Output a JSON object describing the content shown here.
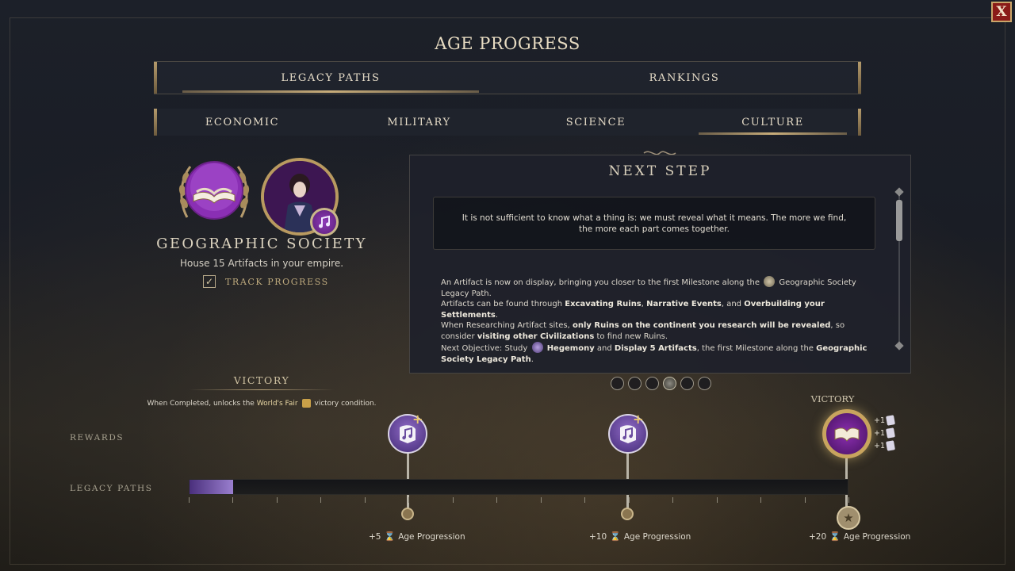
{
  "window": {
    "title": "AGE PROGRESS",
    "close_label": "X"
  },
  "main_tabs": [
    {
      "label": "LEGACY PATHS",
      "active": true
    },
    {
      "label": "RANKINGS",
      "active": false
    }
  ],
  "sub_tabs": [
    {
      "label": "ECONOMIC",
      "active": false
    },
    {
      "label": "MILITARY",
      "active": false
    },
    {
      "label": "SCIENCE",
      "active": false
    },
    {
      "label": "CULTURE",
      "active": true
    }
  ],
  "legacy": {
    "name": "GEOGRAPHIC SOCIETY",
    "description": "House 15 Artifacts in your empire.",
    "track_label": "TRACK PROGRESS",
    "track_checked": true,
    "icons": [
      "open-book-icon",
      "leader-portrait",
      "music-note-icon"
    ]
  },
  "next_step": {
    "title": "NEXT STEP",
    "quote": "It is not sufficient to know what a thing is: we must reveal what it means. The more we find, the more each part comes together.",
    "body": {
      "p1_a": "An Artifact is now on display, bringing you closer to the first Milestone along the",
      "p1_b": "Geographic Society Legacy Path.",
      "p2_a": "Artifacts can be found through",
      "p2_b1": "Excavating Ruins",
      "p2_sep1": ",",
      "p2_b2": "Narrative Events",
      "p2_sep2": ", and",
      "p2_b3": "Overbuilding your Settlements",
      "p2_end": ".",
      "p3_a": "When Researching Artifact sites,",
      "p3_b": "only Ruins on the continent you research will be revealed",
      "p3_c": ", so consider",
      "p3_d": "visiting other Civilizations",
      "p3_e": "to find new Ruins.",
      "p4_a": "Next Objective: Study",
      "p4_b1": "Hegemony",
      "p4_c": "and",
      "p4_b2": "Display 5 Artifacts",
      "p4_d": ", the first Milestone along the",
      "p4_b3": "Geographic Society Legacy Path",
      "p4_end": "."
    },
    "pages": 6,
    "active_page": 4
  },
  "victory": {
    "title": "VICTORY",
    "desc_a": "When Completed, unlocks the",
    "desc_highlight": "World's Fair",
    "desc_b": "victory condition."
  },
  "labels": {
    "rewards": "REWARDS",
    "legacy_paths": "LEGACY PATHS",
    "victory_right": "VICTORY"
  },
  "progress": {
    "fraction": 0.066
  },
  "milestones": [
    {
      "value": "+5",
      "label": "Age Progression"
    },
    {
      "value": "+10",
      "label": "Age Progression"
    },
    {
      "value": "+20",
      "label": "Age Progression"
    }
  ],
  "victory_rewards": [
    "+1",
    "+1",
    "+1"
  ],
  "colors": {
    "accent_gold": "#c8ad7a",
    "culture_purple": "#8b2fb0",
    "close_red": "#8a1b17"
  }
}
